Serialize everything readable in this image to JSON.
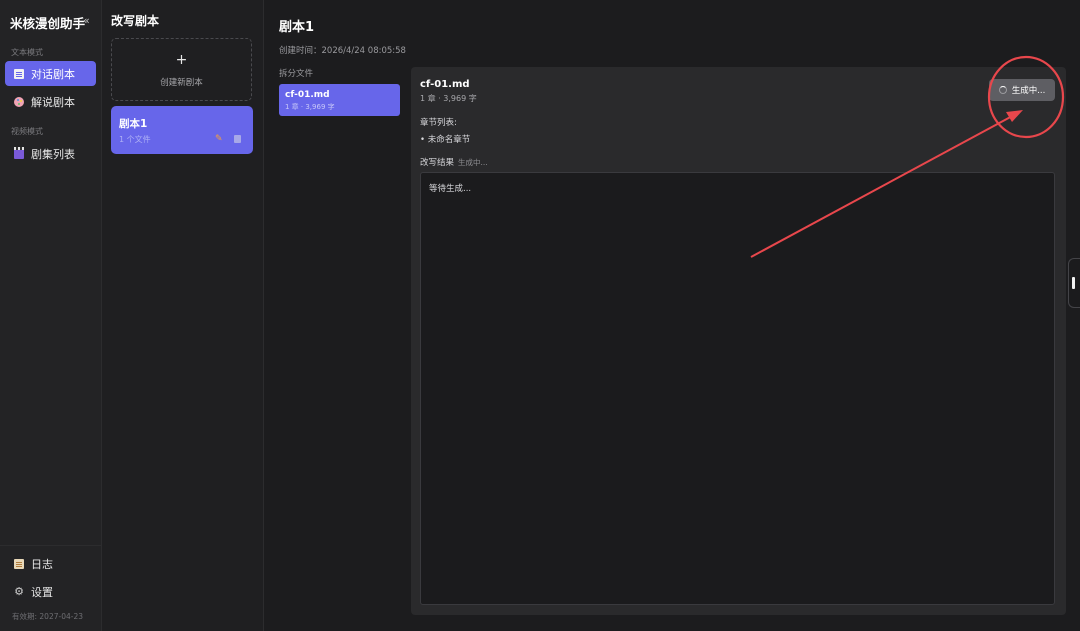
{
  "sidebar": {
    "brand": "米核漫创助手",
    "collapse_glyph": "«",
    "text_mode_label": "文本模式",
    "video_mode_label": "视频模式",
    "items": [
      {
        "label": "对话剧本",
        "icon": "document-icon",
        "active": true
      },
      {
        "label": "解说剧本",
        "icon": "palette-icon",
        "active": false
      },
      {
        "label": "剧集列表",
        "icon": "clapperboard-icon",
        "active": false
      }
    ],
    "bottom_items": [
      {
        "label": "日志",
        "icon": "log-icon"
      },
      {
        "label": "设置",
        "icon": "gear-icon"
      }
    ],
    "expiry": "有效期: 2027-04-23"
  },
  "scripts": {
    "title": "改写剧本",
    "create_plus": "+",
    "create_label": "创建新剧本",
    "items": [
      {
        "name": "剧本1",
        "file_count": "1 个文件"
      }
    ]
  },
  "main": {
    "title": "剧本1",
    "created_time": "创建时间：2026/4/24 08:05:58",
    "split_files_label": "拆分文件",
    "files": [
      {
        "name": "cf-01.md",
        "meta": "1 章 · 3,969 字"
      }
    ],
    "panel": {
      "file_name": "cf-01.md",
      "file_meta": "1 章 · 3,969 字",
      "chapter_list_label": "章节列表:",
      "chapters": [
        "• 未命名章节"
      ],
      "result_label": "改写结果",
      "result_status": "生成中...",
      "result_text": "等待生成...",
      "generate_button": "生成中..."
    }
  },
  "colors": {
    "accent": "#6766ea",
    "annotation": "#e8474c"
  }
}
